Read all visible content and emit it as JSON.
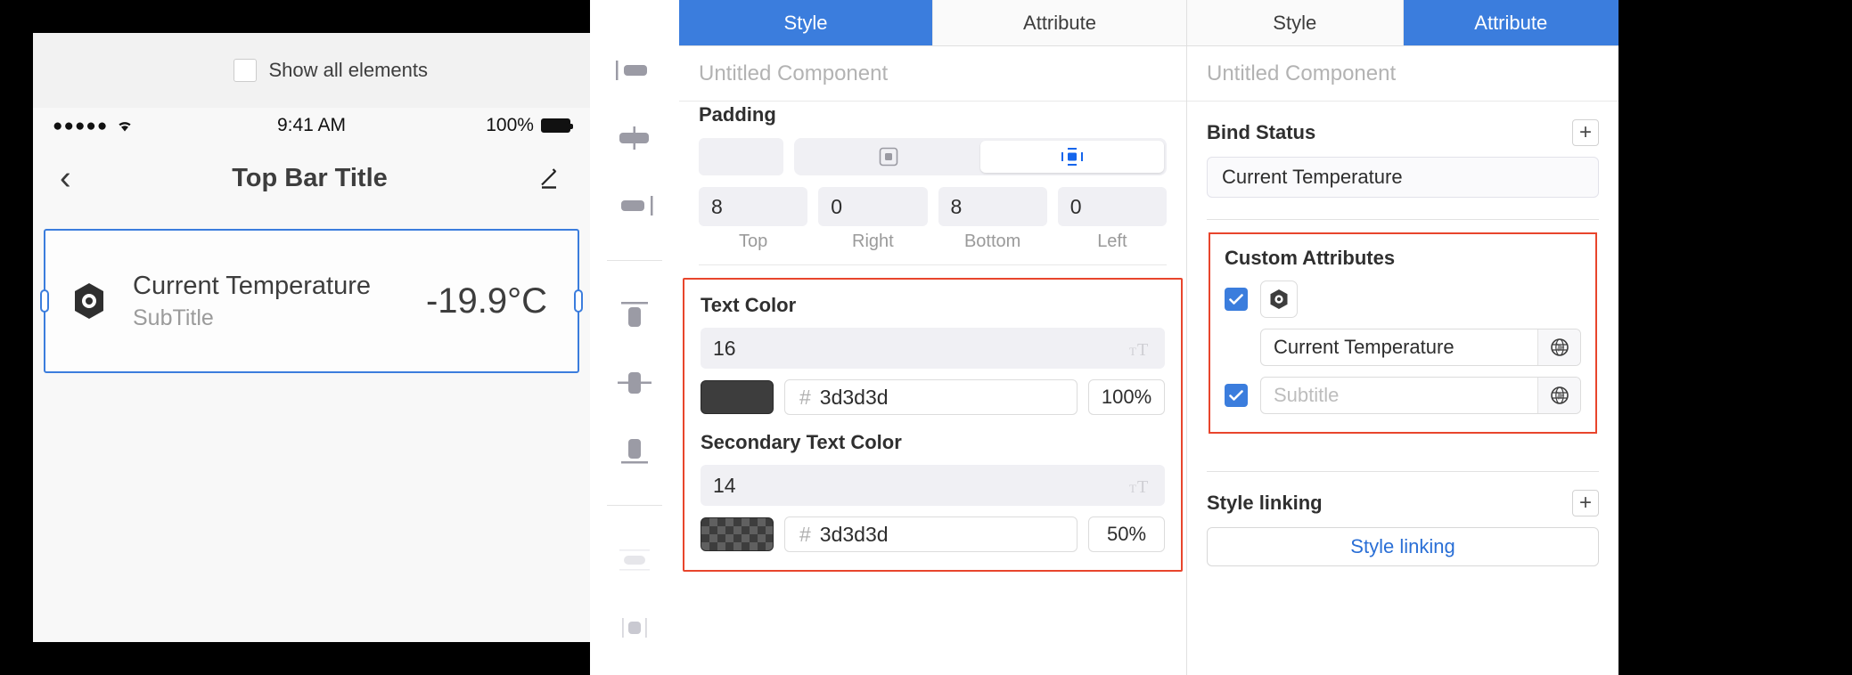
{
  "preview": {
    "show_all_label": "Show all elements",
    "show_all_checked": false,
    "statusbar": {
      "signal": "●●●●●",
      "time": "9:41 AM",
      "battery_pct": "100%"
    },
    "topbar": {
      "back_icon": "chevron-left-icon",
      "title": "Top Bar Title",
      "edit_icon": "pencil-icon"
    },
    "card": {
      "icon": "sensor-hex-icon",
      "title": "Current Temperature",
      "subtitle": "SubTitle",
      "value": "-19.9°C",
      "selected": true,
      "selection_color": "#3b7ddd"
    }
  },
  "align_tools": [
    {
      "name": "align-left-icon"
    },
    {
      "name": "align-center-horizontal-icon"
    },
    {
      "name": "align-right-icon"
    },
    {
      "name": "align-top-icon"
    },
    {
      "name": "align-center-vertical-icon"
    },
    {
      "name": "align-bottom-icon"
    },
    {
      "name": "distribute-horizontal-icon"
    },
    {
      "name": "distribute-vertical-icon"
    }
  ],
  "style_panel": {
    "tabs": [
      {
        "label": "Style",
        "active": true
      },
      {
        "label": "Attribute",
        "active": false
      }
    ],
    "component_name_placeholder": "Untitled Component",
    "padding": {
      "label": "Padding",
      "mode_icons": [
        "padding-all-icon",
        "padding-sides-icon"
      ],
      "active_mode_index": 1,
      "values": [
        {
          "value": "8",
          "caption": "Top"
        },
        {
          "value": "0",
          "caption": "Right"
        },
        {
          "value": "8",
          "caption": "Bottom"
        },
        {
          "value": "0",
          "caption": "Left"
        }
      ]
    },
    "text_color": {
      "label": "Text Color",
      "font_size": "16",
      "font_size_icon": "font-size-icon",
      "swatch_hex": "#3d3d3d",
      "hash": "#",
      "hex": "3d3d3d",
      "opacity": "100%"
    },
    "secondary_text_color": {
      "label": "Secondary Text Color",
      "font_size": "14",
      "font_size_icon": "font-size-icon",
      "swatch_hex": "#3d3d3d",
      "hash": "#",
      "hex": "3d3d3d",
      "opacity": "50%"
    },
    "highlight_color": "#e8452c"
  },
  "attribute_panel": {
    "tabs": [
      {
        "label": "Style",
        "active": false
      },
      {
        "label": "Attribute",
        "active": true
      }
    ],
    "component_name_placeholder": "Untitled Component",
    "bind_status": {
      "label": "Bind Status",
      "add_icon": "plus-icon",
      "value": "Current Temperature"
    },
    "custom_attributes": {
      "label": "Custom Attributes",
      "highlight_color": "#e8452c",
      "rows": [
        {
          "checked": true,
          "has_icon_button": true,
          "icon": "sensor-hex-icon",
          "value": "",
          "placeholder": "",
          "globe_icon": "globe-icon"
        },
        {
          "checked": true,
          "has_icon_button": false,
          "icon": "",
          "value": "Current Temperature",
          "placeholder": "",
          "globe_icon": "globe-icon"
        },
        {
          "checked": true,
          "has_icon_button": false,
          "icon": "",
          "value": "",
          "placeholder": "Subtitle",
          "globe_icon": "globe-icon"
        }
      ]
    },
    "style_linking": {
      "label": "Style linking",
      "add_icon": "plus-icon",
      "button_label": "Style linking"
    }
  }
}
